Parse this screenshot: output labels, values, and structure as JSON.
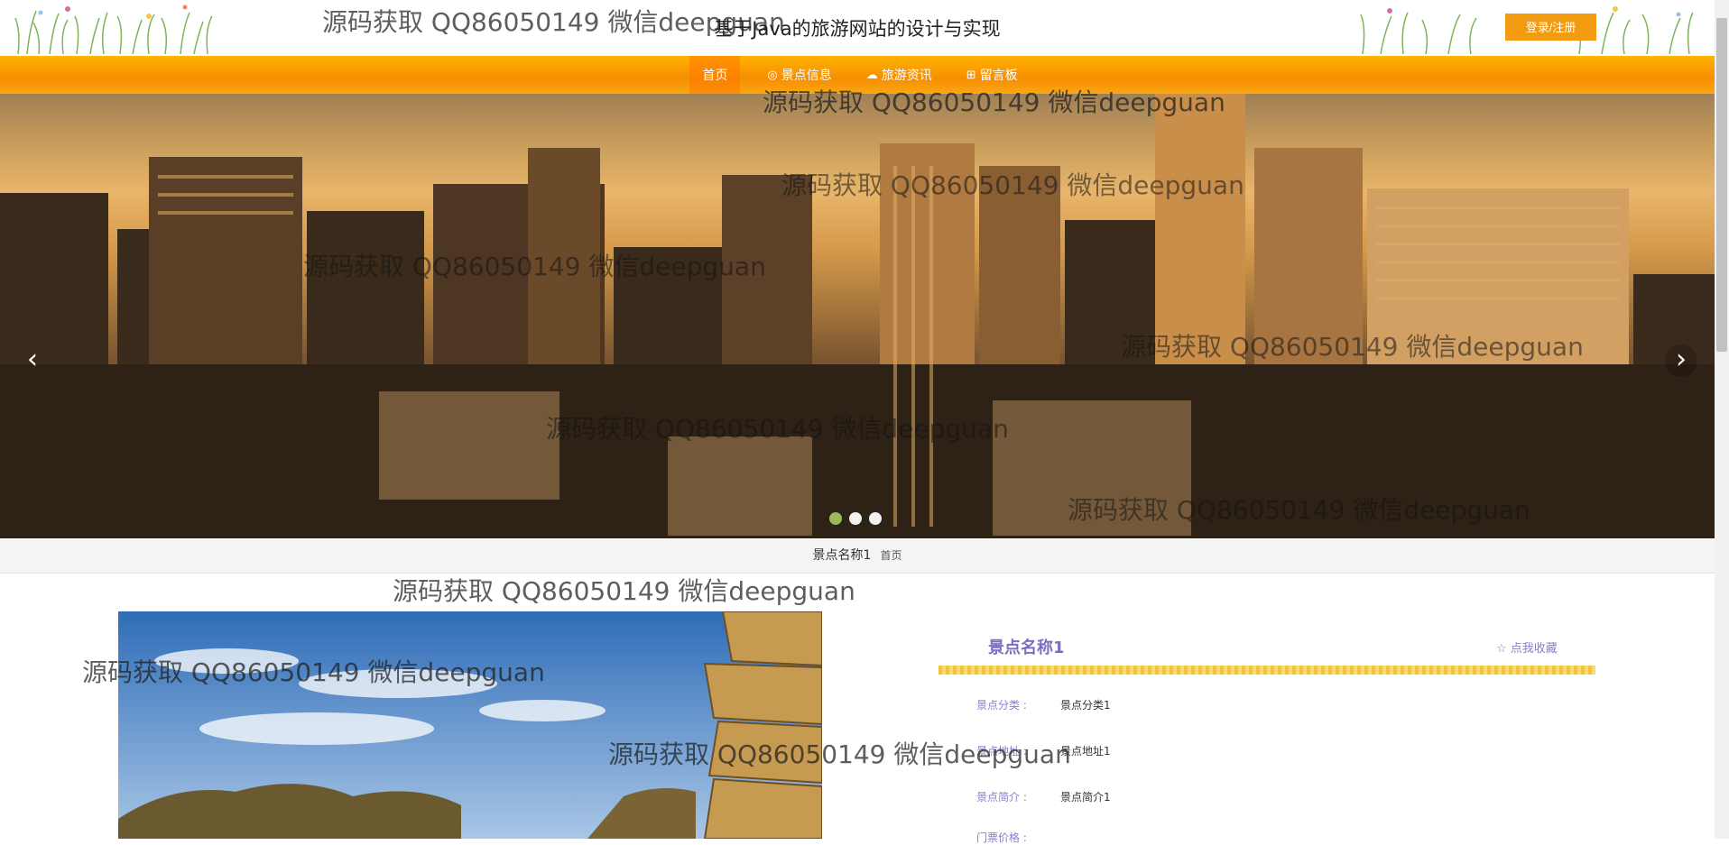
{
  "site": {
    "title": "基于Java的旅游网站的设计与实现",
    "login_label": "登录/注册"
  },
  "nav": [
    {
      "label": "首页",
      "icon": "home-icon",
      "glyph": ""
    },
    {
      "label": "景点信息",
      "icon": "map-pin-icon",
      "glyph": "◎"
    },
    {
      "label": "旅游资讯",
      "icon": "news-icon",
      "glyph": "☁"
    },
    {
      "label": "留言板",
      "icon": "message-board-icon",
      "glyph": "⊞"
    }
  ],
  "carousel": {
    "prev_label": "‹",
    "next_label": "›",
    "active_index": 0,
    "slides": 3
  },
  "breadcrumb": {
    "current": "景点名称1",
    "home": "首页"
  },
  "detail": {
    "name": "景点名称1",
    "favorite_label": "☆ 点我收藏",
    "fields": [
      {
        "label": "景点分类 :",
        "value": "景点分类1"
      },
      {
        "label": "景点地址 :",
        "value": "景点地址1"
      },
      {
        "label": "景点简介 :",
        "value": "景点简介1"
      },
      {
        "label": "门票价格 :",
        "value": ""
      }
    ]
  },
  "watermark": {
    "text": "源码获取 QQ86050149 微信deepguan"
  },
  "colors": {
    "nav_orange": "#f78e00",
    "login_button": "#f39c12",
    "accent_purple": "#7b6fc2",
    "dot_active": "#9bb85a"
  }
}
